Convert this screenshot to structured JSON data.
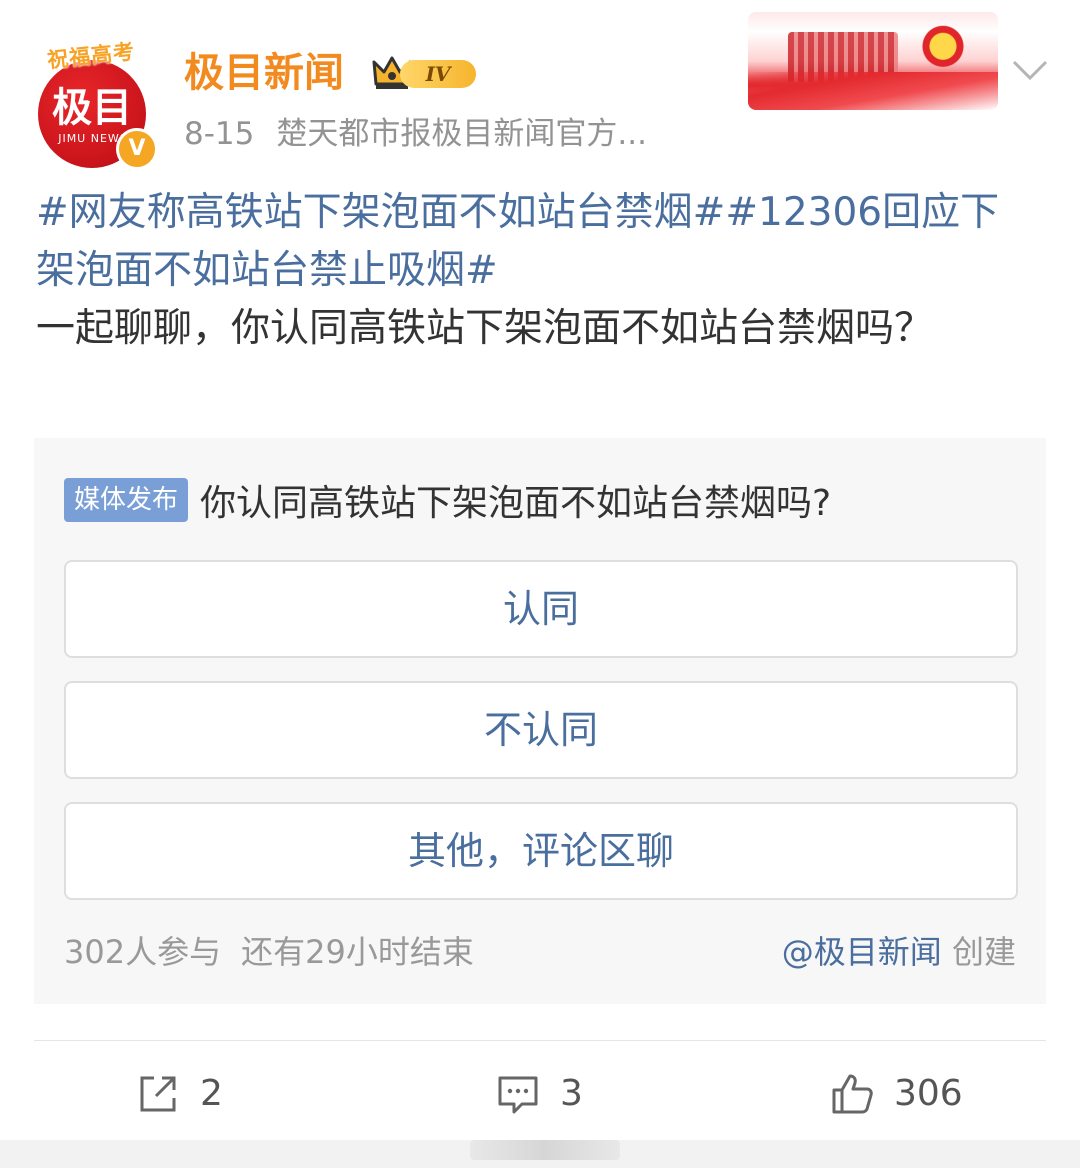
{
  "header": {
    "avatar_ribbon": "祝福高考",
    "avatar_logo": "极目",
    "avatar_sub": "JIMU NEWS",
    "verified_mark": "V",
    "user_name": "极目新闻",
    "level": "IV",
    "date": "8-15",
    "source": "楚天都市报极目新闻官方..."
  },
  "post": {
    "tag1": "#网友称高铁站下架泡面不如站台禁烟#",
    "tag2": "#12306回应下架泡面不如站台禁止吸烟#",
    "body": "一起聊聊，你认同高铁站下架泡面不如站台禁烟吗？"
  },
  "vote": {
    "media_tag": "媒体发布",
    "question": "你认同高铁站下架泡面不如站台禁烟吗?",
    "options": [
      "认同",
      "不认同",
      "其他，评论区聊"
    ],
    "participants": "302人参与",
    "time_left": "还有29小时结束",
    "creator_link": "@极目新闻",
    "creator_suffix": "创建"
  },
  "actions": {
    "repost_count": "2",
    "comment_count": "3",
    "like_count": "306"
  },
  "icons": {
    "repost": "repost-icon",
    "comment": "comment-icon",
    "like": "like-icon",
    "chevron": "chevron-down-icon"
  },
  "colors": {
    "user_name": "#f28a1e",
    "link": "#4a6e9e",
    "media_tag_bg": "#7a9fd6",
    "meta": "#939393"
  }
}
